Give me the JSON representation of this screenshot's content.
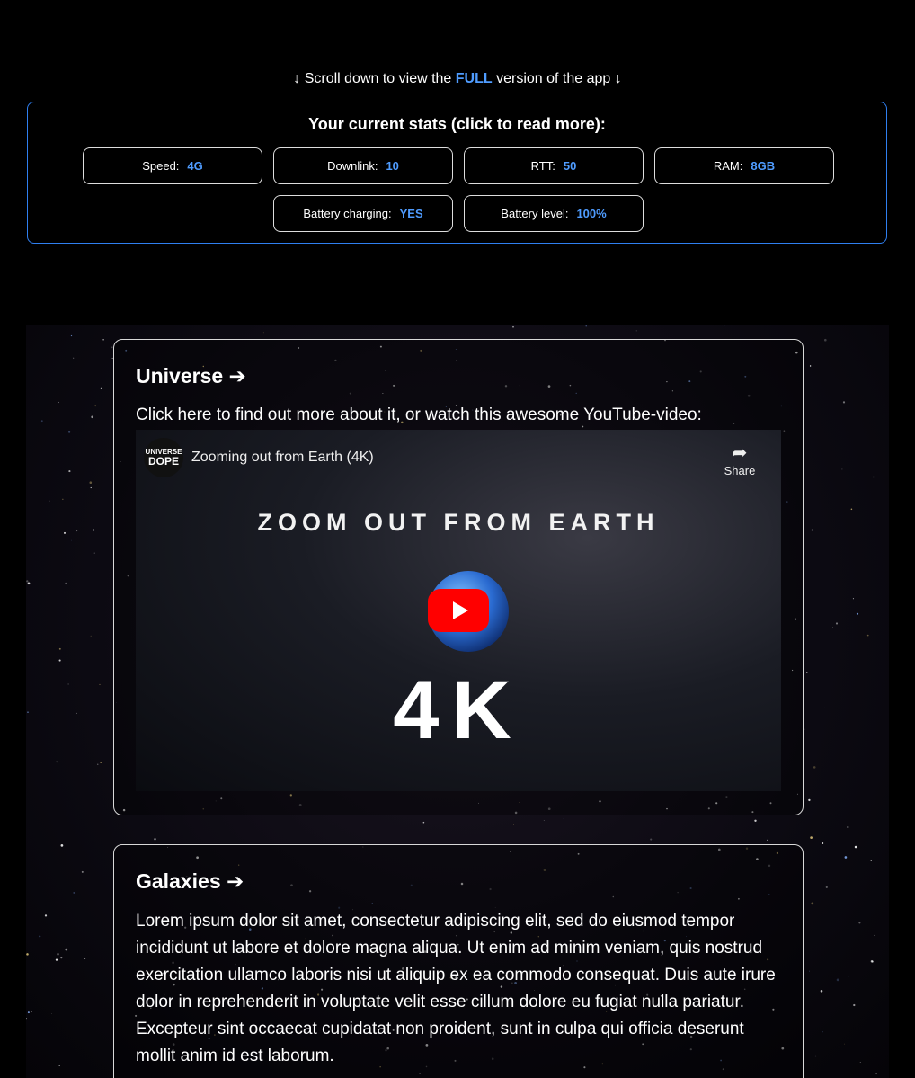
{
  "banner": {
    "prefix": "↓ Scroll down to view the ",
    "highlight": "FULL",
    "suffix": " version of the app ↓"
  },
  "stats": {
    "title": "Your current stats (click to read more):",
    "items": [
      {
        "label": "Speed:",
        "value": "4G"
      },
      {
        "label": "Downlink:",
        "value": "10"
      },
      {
        "label": "RTT:",
        "value": "50"
      },
      {
        "label": "RAM:",
        "value": "8GB"
      },
      {
        "label": "Battery charging:",
        "value": "YES"
      },
      {
        "label": "Battery level:",
        "value": "100%"
      }
    ]
  },
  "sections": [
    {
      "title": "Universe ➔",
      "lead": "Click here to find out more about it, or watch this awesome YouTube-video:",
      "video": {
        "channel_line1": "UNIVERSE",
        "channel_line2": "DOPE",
        "title": "Zooming out from Earth (4K)",
        "share_label": "Share",
        "overlay_text": "ZOOM OUT FROM EARTH",
        "big_text": "4K"
      }
    },
    {
      "title": "Galaxies ➔",
      "body": "Lorem ipsum dolor sit amet, consectetur adipiscing elit, sed do eiusmod tempor incididunt ut labore et dolore magna aliqua. Ut enim ad minim veniam, quis nostrud exercitation ullamco laboris nisi ut aliquip ex ea commodo consequat. Duis aute irure dolor in reprehenderit in voluptate velit esse cillum dolore eu fugiat nulla pariatur. Excepteur sint occaecat cupidatat non proident, sunt in culpa qui officia deserunt mollit anim id est laborum."
    }
  ],
  "colors": {
    "accent": "#4f9cff",
    "border": "#2f7ff0",
    "play": "#ff0000"
  }
}
